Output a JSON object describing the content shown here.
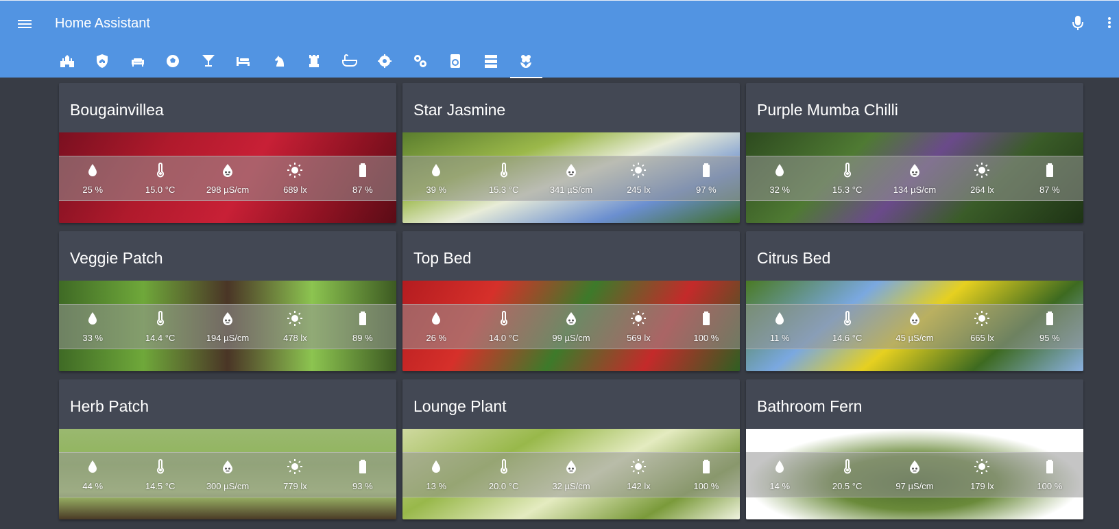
{
  "header": {
    "title": "Home Assistant"
  },
  "icons": {
    "menu": "menu-icon",
    "mic": "microphone-icon",
    "more": "dots-vertical-icon",
    "tabs": [
      "castle-home-icon",
      "shield-home-icon",
      "sofa-icon",
      "soccer-icon",
      "glass-cocktail-icon",
      "bed-icon",
      "chess-knight-icon",
      "chess-rook-icon",
      "bathtub-icon",
      "gear-icon",
      "gears-icon",
      "washing-machine-icon",
      "server-icon",
      "flower-icon"
    ],
    "sensors": [
      "water-drop-icon",
      "thermometer-icon",
      "fertilizer-icon",
      "sun-icon",
      "battery-icon"
    ]
  },
  "colors": {
    "header": "#5294e2",
    "background": "#383c45",
    "card": "#434854",
    "text": "#ffffff"
  },
  "active_tab": 13,
  "plants": [
    {
      "name": "Bougainvillea",
      "moisture": "25 %",
      "temperature": "15.0 °C",
      "conductivity": "298 µS/cm",
      "brightness": "689 lx",
      "battery": "87 %"
    },
    {
      "name": "Star Jasmine",
      "moisture": "39 %",
      "temperature": "15.3 °C",
      "conductivity": "341 µS/cm",
      "brightness": "245 lx",
      "battery": "97 %"
    },
    {
      "name": "Purple Mumba Chilli",
      "moisture": "32 %",
      "temperature": "15.3 °C",
      "conductivity": "134 µS/cm",
      "brightness": "264 lx",
      "battery": "87 %"
    },
    {
      "name": "Veggie Patch",
      "moisture": "33 %",
      "temperature": "14.4 °C",
      "conductivity": "194 µS/cm",
      "brightness": "478 lx",
      "battery": "89 %"
    },
    {
      "name": "Top Bed",
      "moisture": "26 %",
      "temperature": "14.0 °C",
      "conductivity": "99 µS/cm",
      "brightness": "569 lx",
      "battery": "100 %"
    },
    {
      "name": "Citrus Bed",
      "moisture": "11 %",
      "temperature": "14.6 °C",
      "conductivity": "45 µS/cm",
      "brightness": "665 lx",
      "battery": "95 %"
    },
    {
      "name": "Herb Patch",
      "moisture": "44 %",
      "temperature": "14.5 °C",
      "conductivity": "300 µS/cm",
      "brightness": "779 lx",
      "battery": "93 %"
    },
    {
      "name": "Lounge Plant",
      "moisture": "13 %",
      "temperature": "20.0 °C",
      "conductivity": "32 µS/cm",
      "brightness": "142 lx",
      "battery": "100 %"
    },
    {
      "name": "Bathroom Fern",
      "moisture": "14 %",
      "temperature": "20.5 °C",
      "conductivity": "97 µS/cm",
      "brightness": "179 lx",
      "battery": "100 %"
    }
  ]
}
